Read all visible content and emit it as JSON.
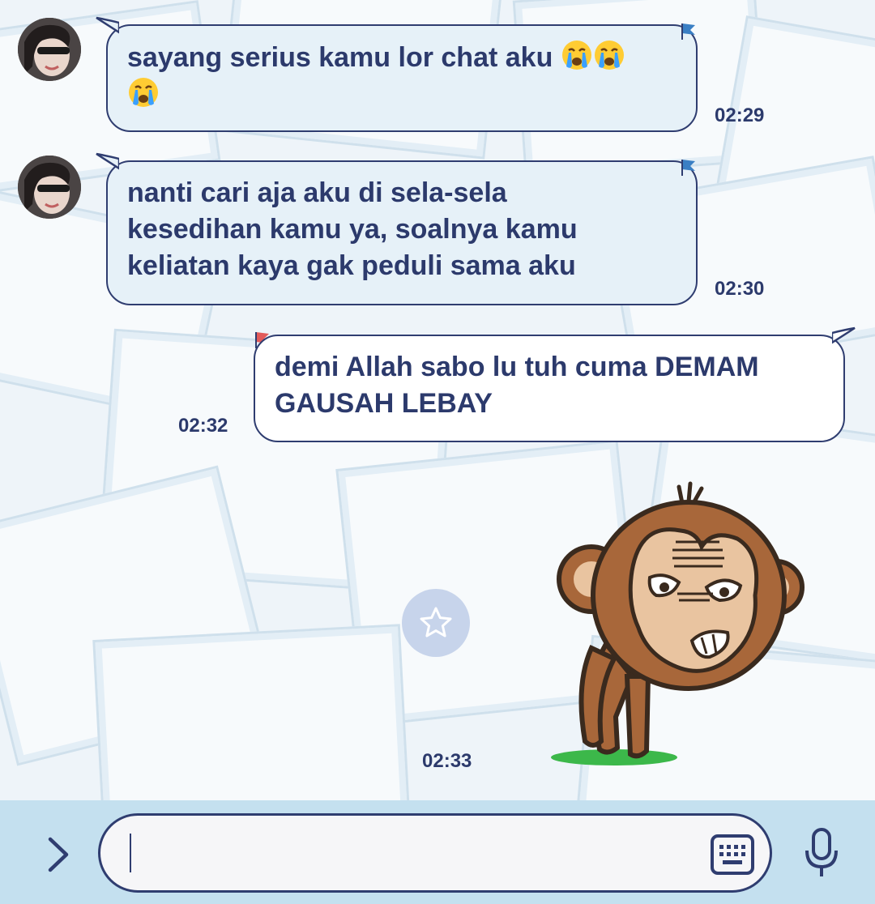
{
  "messages": [
    {
      "direction": "incoming",
      "text_line1": "sayang serius kamu lor chat aku",
      "emoji_line1": [
        "crying-face",
        "crying-face"
      ],
      "emoji_line2": [
        "crying-face"
      ],
      "time": "02:29"
    },
    {
      "direction": "incoming",
      "lines": [
        "nanti cari aja aku di sela-sela",
        "kesedihan kamu ya, soalnya kamu",
        "keliatan kaya gak peduli sama aku"
      ],
      "time": "02:30"
    },
    {
      "direction": "outgoing",
      "lines": [
        "demi Allah sabo lu tuh cuma DEMAM",
        "GAUSAH LEBAY"
      ],
      "time": "02:32"
    },
    {
      "direction": "outgoing",
      "type": "sticker",
      "sticker": "tired-monkey-sticker",
      "time": "02:33"
    }
  ],
  "composer": {
    "value": "",
    "placeholder": ""
  },
  "icons": {
    "expand": "chevron-right-icon",
    "keyboard": "keyboard-icon",
    "microphone": "microphone-icon",
    "favorite": "star-icon"
  },
  "colors": {
    "text": "#2c3a6c",
    "bubble_in": "#e6f1f8",
    "bubble_out": "#ffffff",
    "input_bar": "#c4e0ef"
  }
}
